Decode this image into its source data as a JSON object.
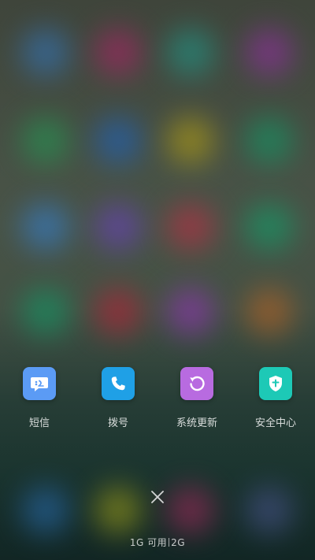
{
  "recent_apps": [
    {
      "label": "短信",
      "icon": "message-icon",
      "color": "#5B9BF5"
    },
    {
      "label": "拨号",
      "icon": "phone-icon",
      "color": "#1FA0E6"
    },
    {
      "label": "系统更新",
      "icon": "update-icon",
      "color": "#B86BE0"
    },
    {
      "label": "安全中心",
      "icon": "shield-icon",
      "color": "#1DC9B6"
    }
  ],
  "close": {
    "icon": "close-icon"
  },
  "memory": {
    "available": "1G 可用",
    "total": "2G"
  }
}
